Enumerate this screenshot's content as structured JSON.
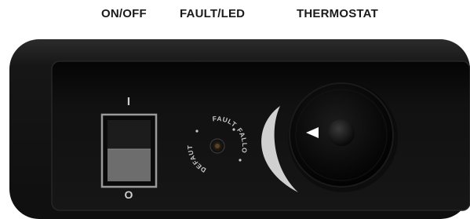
{
  "labels": {
    "on_off": "ON/OFF",
    "fault_led": "FAULT/LED",
    "thermostat": "THERMOSTAT"
  },
  "switch": {
    "on_symbol": "I",
    "off_symbol": "O"
  },
  "led_ring": {
    "text_top": "FAULT",
    "text_right": "FALLO",
    "text_left": "DEFAUT"
  },
  "icons": {
    "thermostat_pointer": "triangle-pointer-icon"
  },
  "colors": {
    "panel": "#151515",
    "recess": "#0d0d0d",
    "switch_upper": "#1c1c1c",
    "switch_lower": "#6d6d6d",
    "arc": "#d0d0d0",
    "knob": "#050505",
    "text": "#1a1a1a",
    "print": "#c8c8c8"
  }
}
